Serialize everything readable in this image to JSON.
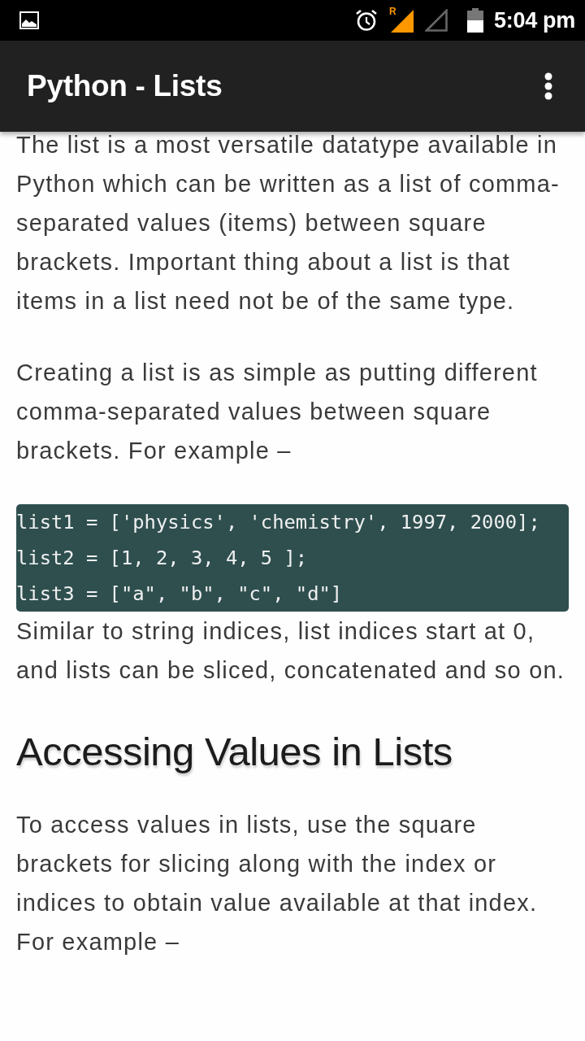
{
  "status_bar": {
    "network_label": "R",
    "time": "5:04 pm"
  },
  "app_bar": {
    "title": "Python - Lists"
  },
  "content": [
    {
      "kind": "paragraph",
      "text": "The list is a most versatile datatype available in Python which can be written as a list of comma-separated values (items) between square brackets. Important thing about a list is that items in a list need not be of the same type."
    },
    {
      "kind": "paragraph",
      "text": "Creating a list is as simple as putting different comma-separated values between square brackets. For example –"
    },
    {
      "kind": "code",
      "lines": [
        "list1 = ['physics', 'chemistry', 1997, 2000];",
        "list2 = [1, 2, 3, 4, 5 ];",
        "list3 = [\"a\", \"b\", \"c\", \"d\"]"
      ]
    },
    {
      "kind": "paragraph",
      "text": "Similar to string indices, list indices start at 0, and lists can be sliced, concatenated and so on."
    },
    {
      "kind": "heading",
      "text": "Accessing Values in Lists"
    },
    {
      "kind": "paragraph",
      "text": "To access values in lists, use the square brackets for slicing along with the index or indices to obtain value available at that index. For example –"
    }
  ]
}
